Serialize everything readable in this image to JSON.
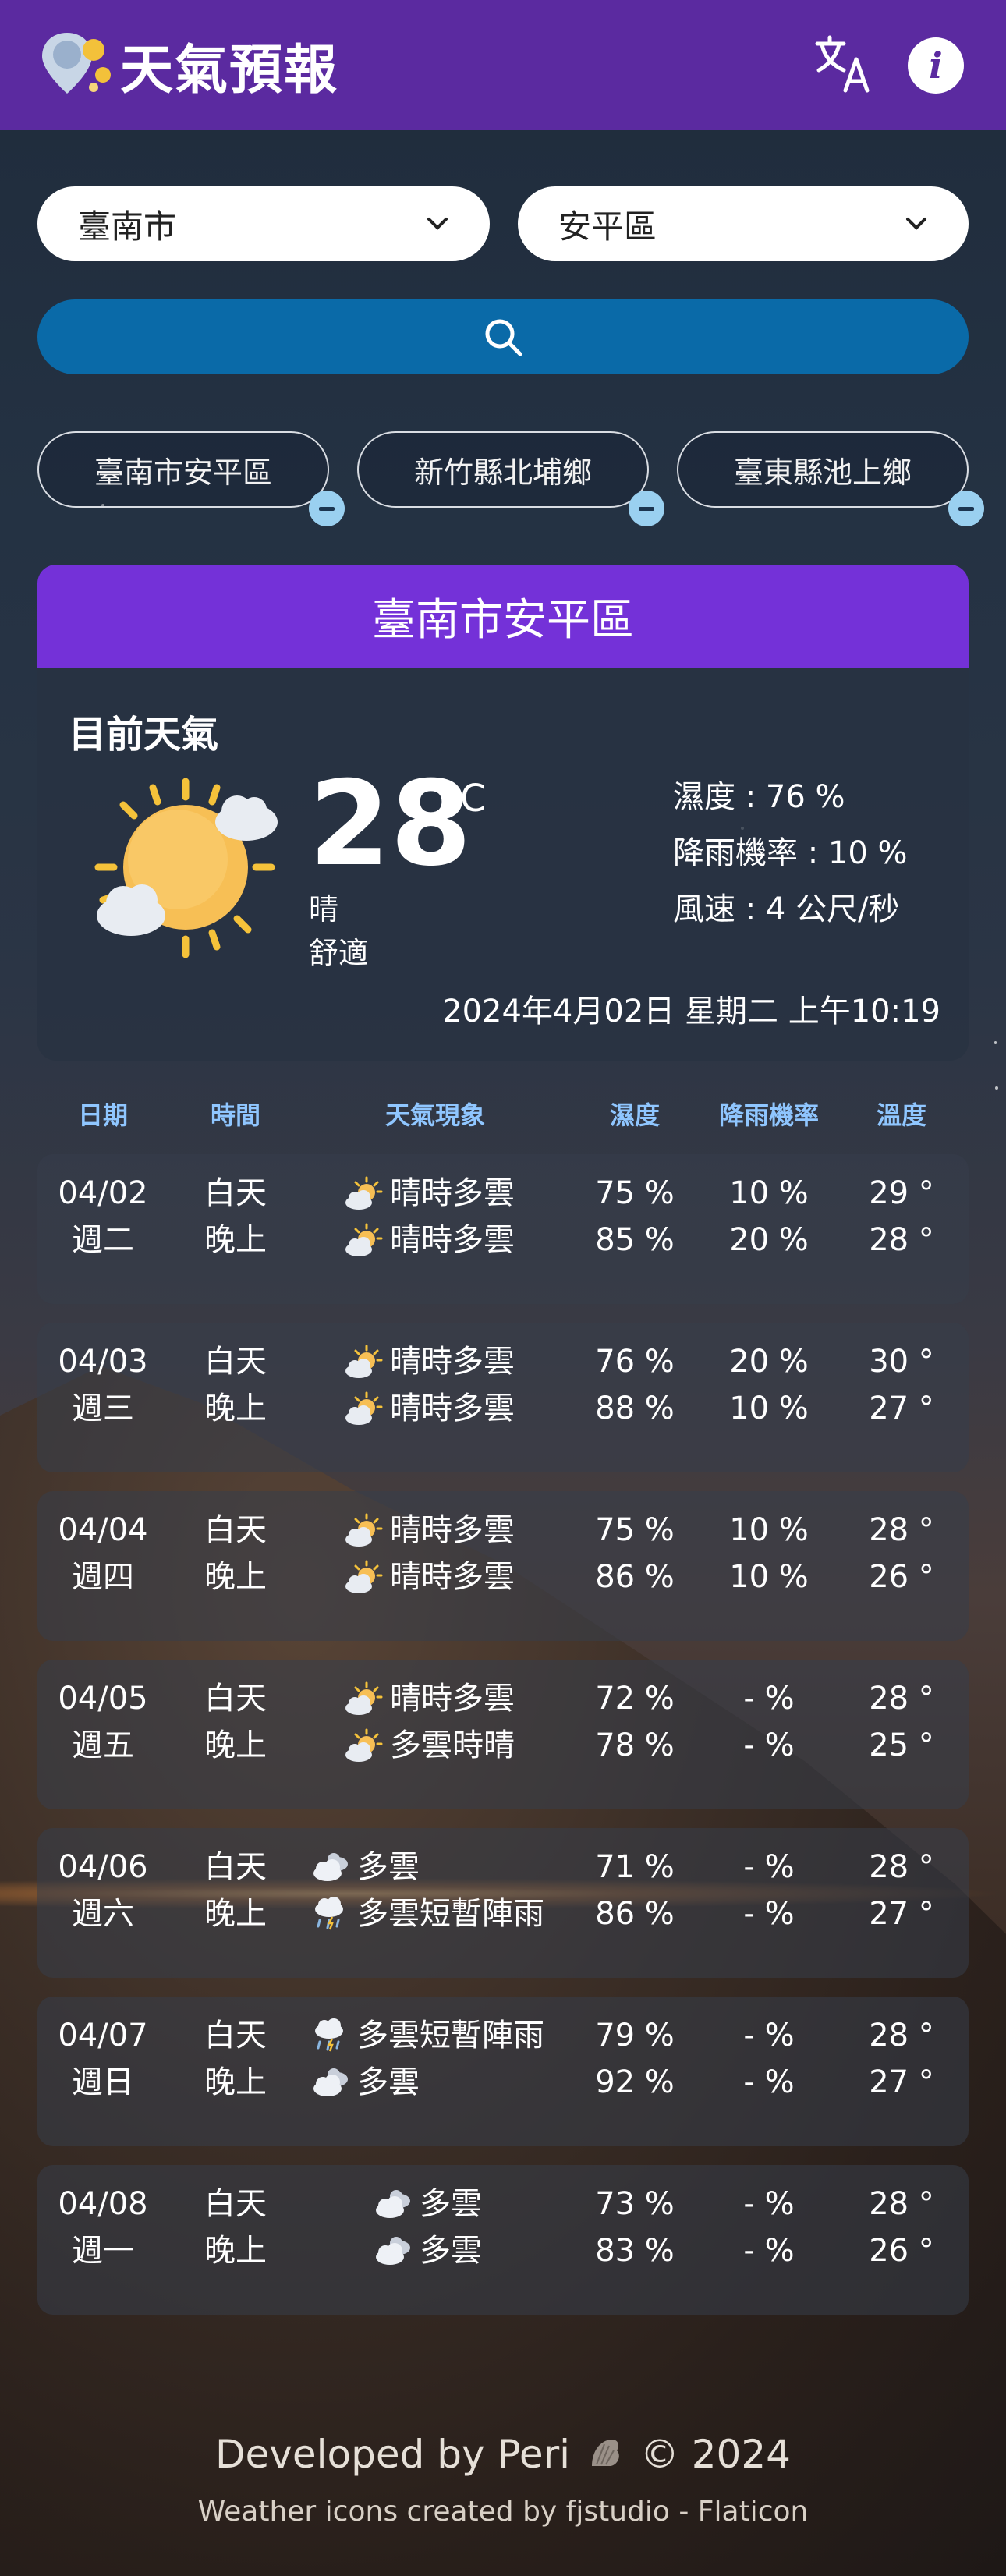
{
  "header": {
    "title": "天氣預報"
  },
  "selects": {
    "city": "臺南市",
    "district": "安平區"
  },
  "favorites": [
    "臺南市安平區",
    "新竹縣北埔鄉",
    "臺東縣池上鄉"
  ],
  "current": {
    "location": "臺南市安平區",
    "section_title": "目前天氣",
    "temperature": "28",
    "unit": "°C",
    "condition": "晴",
    "comfort": "舒適",
    "humidity": "濕度 : 76 %",
    "rain_chance": "降雨機率 : 10 %",
    "wind": "風速 : 4 公尺/秒",
    "datetime": "2024年4月02日 星期二 上午10:19"
  },
  "forecast_columns": [
    "日期",
    "時間",
    "天氣現象",
    "濕度",
    "降雨機率",
    "溫度"
  ],
  "forecast": [
    {
      "date": "04/02",
      "weekday": "週二",
      "day_label": "白天",
      "night_label": "晚上",
      "day_wx": "晴時多雲",
      "night_wx": "晴時多雲",
      "day_icon": "sun-cloud-icon",
      "night_icon": "sun-cloud-icon",
      "day_hum": "75 %",
      "night_hum": "85 %",
      "day_rain": "10 %",
      "night_rain": "20 %",
      "day_temp": "29 °",
      "night_temp": "28 °"
    },
    {
      "date": "04/03",
      "weekday": "週三",
      "day_label": "白天",
      "night_label": "晚上",
      "day_wx": "晴時多雲",
      "night_wx": "晴時多雲",
      "day_icon": "sun-cloud-icon",
      "night_icon": "sun-cloud-icon",
      "day_hum": "76 %",
      "night_hum": "88 %",
      "day_rain": "20 %",
      "night_rain": "10 %",
      "day_temp": "30 °",
      "night_temp": "27 °"
    },
    {
      "date": "04/04",
      "weekday": "週四",
      "day_label": "白天",
      "night_label": "晚上",
      "day_wx": "晴時多雲",
      "night_wx": "晴時多雲",
      "day_icon": "sun-cloud-icon",
      "night_icon": "sun-cloud-icon",
      "day_hum": "75 %",
      "night_hum": "86 %",
      "day_rain": "10 %",
      "night_rain": "10 %",
      "day_temp": "28 °",
      "night_temp": "26 °"
    },
    {
      "date": "04/05",
      "weekday": "週五",
      "day_label": "白天",
      "night_label": "晚上",
      "day_wx": "晴時多雲",
      "night_wx": "多雲時晴",
      "day_icon": "sun-cloud-icon",
      "night_icon": "sun-cloud-icon",
      "day_hum": "72 %",
      "night_hum": "78 %",
      "day_rain": "- %",
      "night_rain": "- %",
      "day_temp": "28 °",
      "night_temp": "25 °"
    },
    {
      "date": "04/06",
      "weekday": "週六",
      "day_label": "白天",
      "night_label": "晚上",
      "day_wx": "多雲",
      "night_wx": "多雲短暫陣雨",
      "day_icon": "cloud-icon",
      "night_icon": "rain-cloud-icon",
      "day_hum": "71 %",
      "night_hum": "86 %",
      "day_rain": "- %",
      "night_rain": "- %",
      "day_temp": "28 °",
      "night_temp": "27 °"
    },
    {
      "date": "04/07",
      "weekday": "週日",
      "day_label": "白天",
      "night_label": "晚上",
      "day_wx": "多雲短暫陣雨",
      "night_wx": "多雲",
      "day_icon": "rain-cloud-icon",
      "night_icon": "cloud-icon",
      "day_hum": "79 %",
      "night_hum": "92 %",
      "day_rain": "- %",
      "night_rain": "- %",
      "day_temp": "28 °",
      "night_temp": "27 °"
    },
    {
      "date": "04/08",
      "weekday": "週一",
      "day_label": "白天",
      "night_label": "晚上",
      "day_wx": "多雲",
      "night_wx": "多雲",
      "day_icon": "cloud-icon",
      "night_icon": "cloud-icon",
      "day_hum": "73 %",
      "night_hum": "83 %",
      "day_rain": "- %",
      "night_rain": "- %",
      "day_temp": "28 °",
      "night_temp": "26 °"
    }
  ],
  "footer": {
    "credit": "Developed by Peri",
    "credit_icon": "shell-icon",
    "year": "© 2024",
    "icons_credit": "Weather icons created by fjstudio - Flaticon"
  }
}
